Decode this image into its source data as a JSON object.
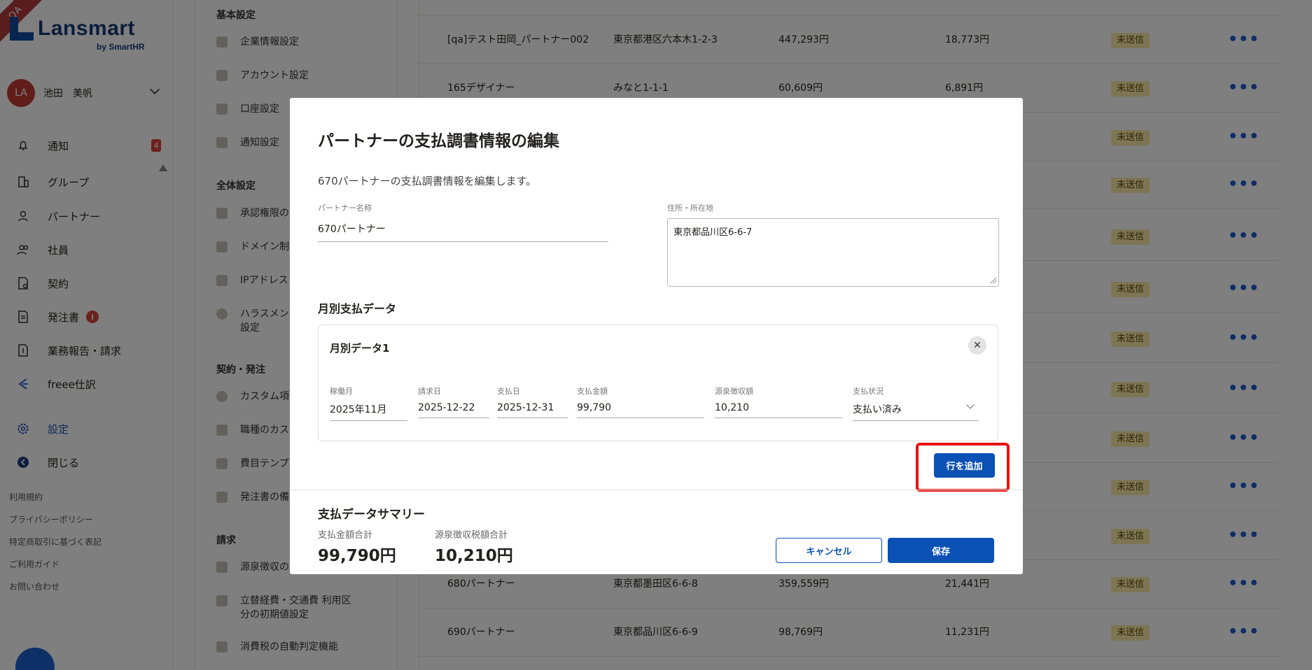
{
  "sidebar": {
    "ribbon": "QA",
    "logo_text": "Lansmart",
    "logo_sub": "by SmartHR",
    "user": {
      "initials": "LA",
      "name": "池田　美帆"
    },
    "nav": [
      {
        "label": "通知",
        "icon": "bell-icon",
        "badge": "4"
      },
      {
        "label": "グループ",
        "icon": "building-icon"
      },
      {
        "label": "パートナー",
        "icon": "person-icon"
      },
      {
        "label": "社員",
        "icon": "people-icon"
      },
      {
        "label": "契約",
        "icon": "contract-icon"
      },
      {
        "label": "発注書",
        "icon": "document-icon",
        "badge": "i"
      },
      {
        "label": "業務報告・請求",
        "icon": "invoice-icon"
      },
      {
        "label": "freee仕訳",
        "icon": "freee-icon"
      },
      {
        "label": "設定",
        "icon": "gear-icon"
      },
      {
        "label": "閉じる",
        "icon": "back-circle-icon"
      }
    ],
    "footer_links": [
      "利用規約",
      "プライバシーポリシー",
      "特定商取引に基づく表記",
      "ご利用ガイド",
      "お問い合わせ"
    ]
  },
  "settings": {
    "sections": [
      {
        "title": "基本設定",
        "items": [
          "企業情報設定",
          "アカウント設定",
          "口座設定",
          "通知設定"
        ]
      },
      {
        "title": "全体設定",
        "items": [
          "承認権限の[",
          "ドメイン制",
          "IPアドレス",
          "ハラスメン 設定"
        ]
      },
      {
        "title": "契約・発注",
        "items": [
          "カスタム項",
          "職種のカス",
          "費目テンプ",
          "発注書の備"
        ]
      },
      {
        "title": "請求",
        "items": [
          "源泉徴収の",
          "立替経費・交通費 利用区分の初期値設定",
          "消費税の自動判定機能"
        ]
      }
    ]
  },
  "list": {
    "rows": [
      {
        "name": "[qa]テスト田岡_パートナー002",
        "address": "東京都港区六本木1-2-3",
        "amount": "447,293円",
        "tax": "18,773円",
        "status": "未送信"
      },
      {
        "name": "165デザイナー",
        "address": "みなと1-1-1",
        "amount": "60,609円",
        "tax": "6,891円",
        "status": "未送信"
      },
      {
        "name": "",
        "address": "",
        "amount": "",
        "tax": "",
        "status": "未送信"
      },
      {
        "name": "",
        "address": "",
        "amount": "",
        "tax": "",
        "status": "未送信"
      },
      {
        "name": "",
        "address": "",
        "amount": "",
        "tax": "",
        "status": "未送信"
      },
      {
        "name": "",
        "address": "",
        "amount": "",
        "tax": "",
        "status": "未送信"
      },
      {
        "name": "",
        "address": "",
        "amount": "",
        "tax": "",
        "status": "未送信"
      },
      {
        "name": "",
        "address": "",
        "amount": "",
        "tax": "",
        "status": "未送信"
      },
      {
        "name": "",
        "address": "",
        "amount": "",
        "tax": "",
        "status": "未送信"
      },
      {
        "name": "",
        "address": "",
        "amount": "",
        "tax": "",
        "status": "未送信"
      },
      {
        "name": "",
        "address": "",
        "amount": "",
        "tax": "",
        "status": "未送信"
      },
      {
        "name": "680パートナー",
        "address": "東京都墨田区6-6-8",
        "amount": "359,559円",
        "tax": "21,441円",
        "status": "未送信"
      },
      {
        "name": "690パートナー",
        "address": "東京都品川区6-6-9",
        "amount": "98,769円",
        "tax": "11,231円",
        "status": "未送信"
      }
    ],
    "more_label": "•••"
  },
  "modal": {
    "title": "パートナーの支払調書情報の編集",
    "description": "670パートナーの支払調書情報を編集します。",
    "partner_name_label": "パートナー名称",
    "partner_name_value": "670パートナー",
    "address_label": "住所・所在地",
    "address_value": "東京都品川区6-6-7",
    "monthly_section_title": "月別支払データ",
    "card_title": "月別データ1",
    "close_label": "✕",
    "fields": {
      "work_month": {
        "label": "稼働月",
        "value": "2025年11月"
      },
      "invoice_date": {
        "label": "請求日",
        "value": "2025-12-22"
      },
      "payment_date": {
        "label": "支払日",
        "value": "2025-12-31"
      },
      "payment_amount": {
        "label": "支払金額",
        "value": "99,790"
      },
      "withholding": {
        "label": "源泉徴収額",
        "value": "10,210"
      },
      "payment_status": {
        "label": "支払状況",
        "value": "支払い済み"
      }
    },
    "add_row_label": "行を追加",
    "summary_title": "支払データサマリー",
    "summary": {
      "total_amount_label": "支払金額合計",
      "total_amount_value": "99,790円",
      "total_tax_label": "源泉徴収税額合計",
      "total_tax_value": "10,210円"
    },
    "cancel_label": "キャンセル",
    "save_label": "保存"
  },
  "colors": {
    "primary": "#0b51b5",
    "highlight": "#e8120c",
    "status_bg": "#fbeaa7",
    "badge": "#d9423a"
  }
}
